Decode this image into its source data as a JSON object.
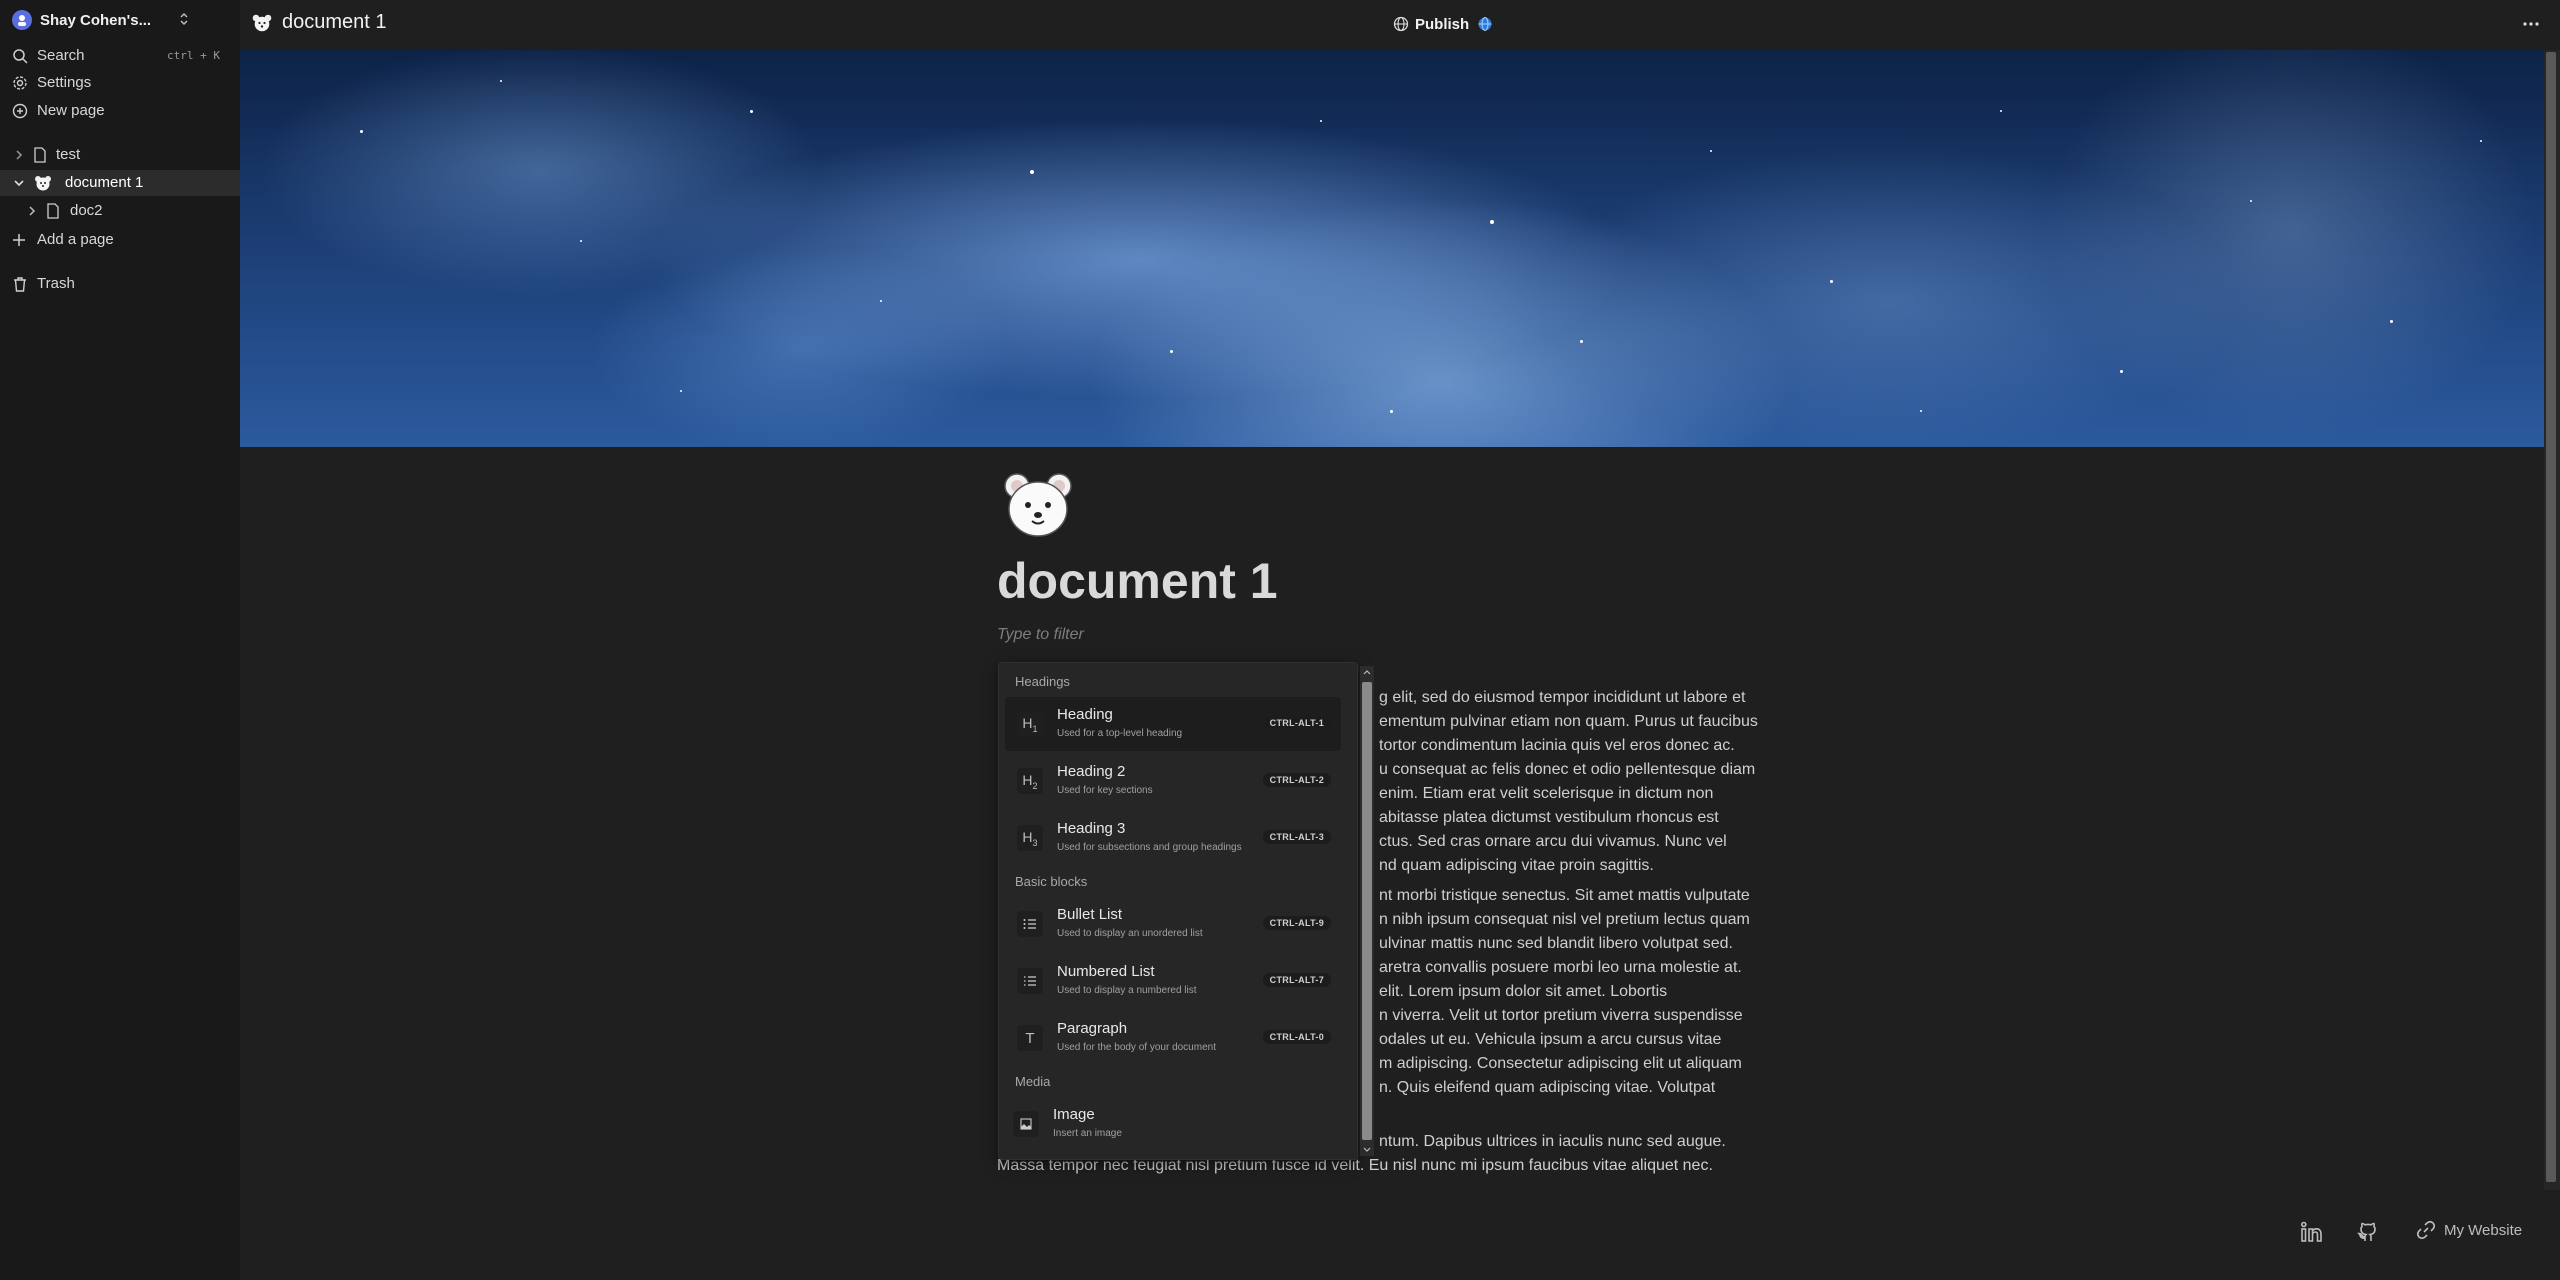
{
  "sidebar": {
    "workspace_name": "Shay Cohen's...",
    "search_label": "Search",
    "search_shortcut": "ctrl + K",
    "settings_label": "Settings",
    "new_page_label": "New page",
    "pages": [
      {
        "label": "test",
        "expanded": false
      },
      {
        "label": "document 1",
        "expanded": true,
        "active": true
      },
      {
        "label": "doc2",
        "expanded": false
      }
    ],
    "add_page_label": "Add a page",
    "trash_label": "Trash"
  },
  "topbar": {
    "doc_title": "document 1",
    "publish_label": "Publish"
  },
  "document": {
    "title": "document 1",
    "emoji": "bear-face",
    "filter_placeholder": "Type to filter",
    "paragraph1": [
      "g elit, sed do eiusmod tempor incididunt ut labore et",
      "ementum pulvinar etiam non quam. Purus ut faucibus",
      "tortor condimentum lacinia quis vel eros donec ac.",
      "u consequat ac felis donec et odio pellentesque diam",
      "enim. Etiam erat velit scelerisque in dictum non",
      "abitasse platea dictumst vestibulum rhoncus est",
      "ctus. Sed cras ornare arcu dui vivamus. Nunc vel",
      "nd quam adipiscing vitae proin sagittis."
    ],
    "paragraph2": [
      "nt morbi tristique senectus. Sit amet mattis vulputate",
      "n nibh ipsum consequat nisl vel pretium lectus quam",
      "ulvinar mattis nunc sed blandit libero volutpat sed.",
      "aretra convallis posuere morbi leo urna molestie at.",
      "elit. Lorem ipsum dolor sit amet. Lobortis",
      "n viverra. Velit ut tortor pretium viverra suspendisse",
      "odales ut eu. Vehicula ipsum a arcu cursus vitae",
      "m adipiscing. Consectetur adipiscing elit ut aliquam",
      "n. Quis eleifend quam adipiscing vitae. Volutpat"
    ],
    "paragraph3": [
      "ntum. Dapibus ultrices in iaculis nunc sed augue.",
      "Massa tempor nec feugiat nisl pretium fusce id velit. Eu nisl nunc mi ipsum faucibus vitae aliquet nec."
    ]
  },
  "menu": {
    "sections": [
      {
        "label": "Headings"
      },
      {
        "label": "Basic blocks"
      },
      {
        "label": "Media"
      }
    ],
    "items": [
      {
        "icon": "heading-1-icon",
        "glyph": "H1",
        "title": "Heading",
        "subtitle": "Used for a top-level heading",
        "shortcut": "CTRL-ALT-1",
        "selected": true
      },
      {
        "icon": "heading-2-icon",
        "glyph": "H2",
        "title": "Heading 2",
        "subtitle": "Used for key sections",
        "shortcut": "CTRL-ALT-2"
      },
      {
        "icon": "heading-3-icon",
        "glyph": "H3",
        "title": "Heading 3",
        "subtitle": "Used for subsections and group headings",
        "shortcut": "CTRL-ALT-3"
      },
      {
        "icon": "bullet-list-icon",
        "title": "Bullet List",
        "subtitle": "Used to display an unordered list",
        "shortcut": "CTRL-ALT-9"
      },
      {
        "icon": "numbered-list-icon",
        "title": "Numbered List",
        "subtitle": "Used to display a numbered list",
        "shortcut": "CTRL-ALT-7"
      },
      {
        "icon": "paragraph-icon",
        "glyph": "T",
        "title": "Paragraph",
        "subtitle": "Used for the body of your document",
        "shortcut": "CTRL-ALT-0"
      },
      {
        "icon": "image-icon",
        "title": "Image",
        "subtitle": "Insert an image"
      }
    ]
  },
  "footer": {
    "website_label": "My Website",
    "icons": [
      "linkedin-icon",
      "github-icon",
      "link-icon"
    ]
  },
  "colors": {
    "background": "#1f1f1f",
    "sidebar": "#191919",
    "accent_workspace": "#5b6ee1",
    "spellcheck": "#c0392b"
  }
}
